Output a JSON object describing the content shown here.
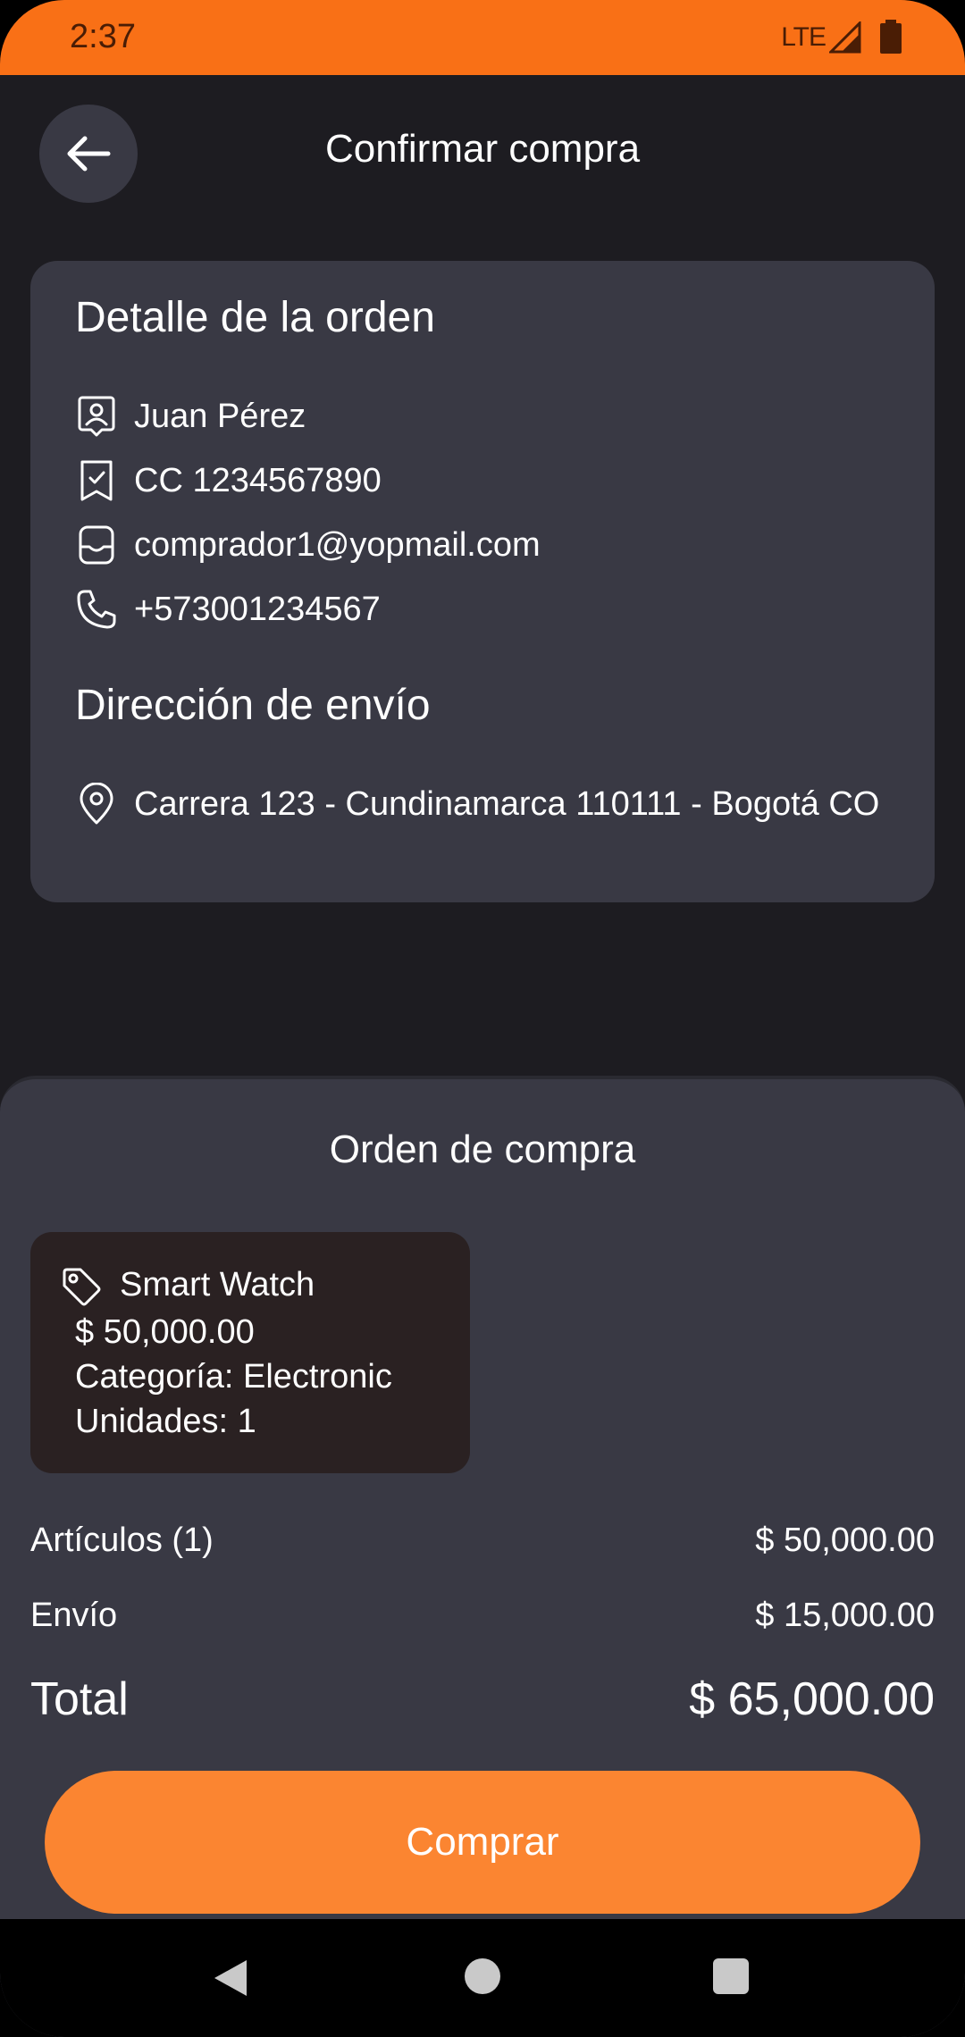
{
  "status_bar": {
    "time": "2:37",
    "network": "LTE"
  },
  "app_bar": {
    "title": "Confirmar compra",
    "back_icon": "arrow-left-icon"
  },
  "order_detail": {
    "title": "Detalle de la orden",
    "name": "Juan Pérez",
    "document": "CC 1234567890",
    "email": "comprador1@yopmail.com",
    "phone": "+573001234567"
  },
  "shipping": {
    "title": "Dirección de envío",
    "address": "Carrera 123 - Cundinamarca 110111 - Bogotá CO"
  },
  "purchase_order": {
    "title": "Orden de compra",
    "product": {
      "name": "Smart Watch",
      "price": "$ 50,000.00",
      "category": "Categoría: Electronic",
      "units": "Unidades: 1"
    }
  },
  "summary": {
    "items_label": "Artículos (1)",
    "items_value": "$ 50,000.00",
    "shipping_label": "Envío",
    "shipping_value": "$ 15,000.00",
    "total_label": "Total",
    "total_value": "$ 65,000.00"
  },
  "buy_button": {
    "label": "Comprar"
  },
  "colors": {
    "accent": "#fb8531",
    "status_bar": "#f97016",
    "background": "#1d1c21",
    "card": "#393944"
  }
}
